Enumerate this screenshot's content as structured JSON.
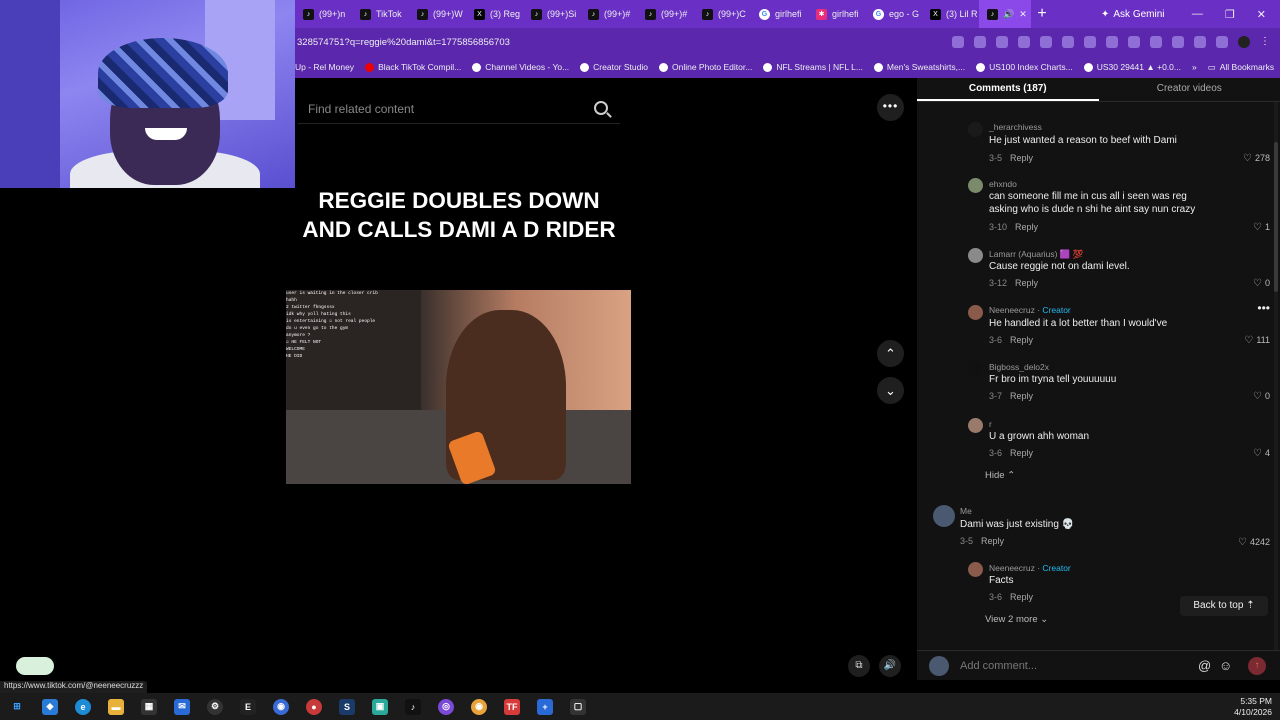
{
  "browser": {
    "tabs": [
      {
        "label": "(99+)n",
        "icon": "tiktok-icon"
      },
      {
        "label": "TikTok",
        "icon": "tiktok-icon"
      },
      {
        "label": "(99+)W",
        "icon": "tiktok-icon"
      },
      {
        "label": "(3) Reg",
        "icon": "x-icon"
      },
      {
        "label": "(99+)Si",
        "icon": "tiktok-icon"
      },
      {
        "label": "(99+)#",
        "icon": "tiktok-icon"
      },
      {
        "label": "(99+)#",
        "icon": "tiktok-icon"
      },
      {
        "label": "(99+)C",
        "icon": "tiktok-icon"
      },
      {
        "label": "girlhefi",
        "icon": "google-icon"
      },
      {
        "label": "girlhefi",
        "icon": "pink-star-icon"
      },
      {
        "label": "ego - G",
        "icon": "google-icon"
      },
      {
        "label": "(3) Lil R",
        "icon": "x-icon"
      }
    ],
    "active_tab_icon": "tiktok-icon",
    "gemini_label": "Ask Gemini",
    "url": "328574751?q=reggie%20dami&t=1775856856703",
    "bookmarks": [
      {
        "label": "Up - Rel Money",
        "icon": ""
      },
      {
        "label": "Black TikTok Compil...",
        "icon": "youtube-icon"
      },
      {
        "label": "Channel Videos - Yo...",
        "icon": "globe-icon"
      },
      {
        "label": "Creator Studio",
        "icon": "globe-icon"
      },
      {
        "label": "Online Photo Editor...",
        "icon": "globe-icon"
      },
      {
        "label": "NFL Streams | NFL L...",
        "icon": "globe-icon"
      },
      {
        "label": "Men's Sweatshirts,...",
        "icon": "globe-icon"
      },
      {
        "label": "US100 Index Charts...",
        "icon": "globe-icon"
      },
      {
        "label": "US30 29441 ▲ +0.0...",
        "icon": "globe-icon"
      }
    ],
    "all_bookmarks": "All Bookmarks"
  },
  "video": {
    "search_placeholder": "Find related content",
    "headline": "REGGIE DOUBLES DOWN AND CALLS DAMI A D RIDER",
    "chat_lines": [
      "user is waiting in the closer crib",
      "hahh",
      "2  twitter fkngsssx",
      "idk why yoll hating this",
      "is entertaining ☺ not real people",
      "do u even go to the gym",
      "anymore ?",
      "☺  HE FELT NOT",
      "WELCOME",
      "HE DID"
    ]
  },
  "comments_panel": {
    "tabs": [
      {
        "label": "Comments (187)",
        "active": true
      },
      {
        "label": "Creator videos",
        "active": false
      }
    ],
    "comments": [
      {
        "user": "_herarchivess",
        "creator": false,
        "text": "He just wanted a reason to beef with Dami",
        "date": "3-5",
        "reply": "Reply",
        "likes": "278"
      },
      {
        "user": "ehxndo",
        "creator": false,
        "text": "can someone fill me in cus all i seen was reg",
        "text2": "asking who is dude n shi he aint say nun crazy",
        "date": "3-10",
        "reply": "Reply",
        "likes": "1"
      },
      {
        "user": "Lamarr (Aquarius) 🟪 💯",
        "creator": false,
        "text": "Cause reggie not on dami level.",
        "date": "3-12",
        "reply": "Reply",
        "likes": "0"
      },
      {
        "user": "Neeneecruz",
        "creator": true,
        "text": "He handled it a lot better than I would've",
        "date": "3-6",
        "reply": "Reply",
        "likes": "111"
      },
      {
        "user": "Bigboss_delo2x",
        "creator": false,
        "text": "Fr bro im tryna tell youuuuuu",
        "date": "3-7",
        "reply": "Reply",
        "likes": "0"
      },
      {
        "user": "r",
        "creator": false,
        "text": "U a grown ahh woman",
        "date": "3-6",
        "reply": "Reply",
        "likes": "4"
      }
    ],
    "hide_label": "Hide",
    "me_comment": {
      "user": "Me",
      "text": "Dami was just existing 💀",
      "date": "3-5",
      "reply": "Reply",
      "likes": "4242"
    },
    "creator_reply": {
      "user": "Neeneecruz",
      "creator_label": "Creator",
      "text": "Facts",
      "date": "3-6",
      "reply": "Reply"
    },
    "view_more": "View 2 more",
    "back_to_top": "Back to top",
    "add_comment_placeholder": "Add comment...",
    "creator_label": "Creator"
  },
  "status_bar_url": "https://www.tiktok.com/@neeneecruzzz",
  "taskbar": {
    "time": "5:35 PM",
    "date": "4/10/2026"
  }
}
